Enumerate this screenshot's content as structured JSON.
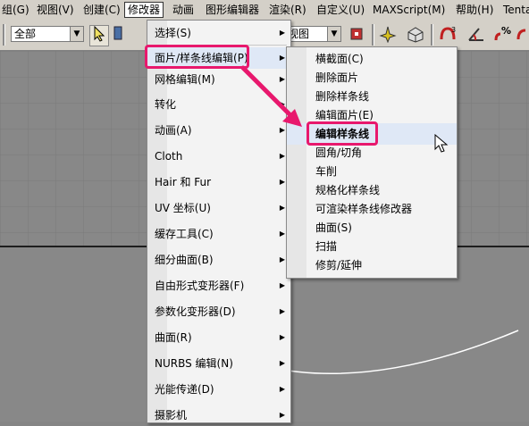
{
  "menubar": {
    "items": [
      "组(G)",
      "视图(V)",
      "创建(C)",
      "修改器",
      "动画",
      "图形编辑器",
      "渲染(R)",
      "自定义(U)",
      "MAXScript(M)",
      "帮助(H)",
      "Tenta"
    ]
  },
  "toolbar": {
    "selection_filter": "全部",
    "view_combo": "视图"
  },
  "modifiers_menu": {
    "items": [
      {
        "label": "选择(S)"
      },
      {
        "label": "面片/样条线编辑(P)"
      },
      {
        "label": "网格编辑(M)"
      },
      {
        "label": "转化"
      },
      {
        "label": "动画(A)"
      },
      {
        "label": "Cloth"
      },
      {
        "label": "Hair 和 Fur"
      },
      {
        "label": "UV 坐标(U)"
      },
      {
        "label": "缓存工具(C)"
      },
      {
        "label": "细分曲面(B)"
      },
      {
        "label": "自由形式变形器(F)"
      },
      {
        "label": "参数化变形器(D)"
      },
      {
        "label": "曲面(R)"
      },
      {
        "label": "NURBS 编辑(N)"
      },
      {
        "label": "光能传递(D)"
      },
      {
        "label": "摄影机"
      }
    ]
  },
  "patch_spline_submenu": {
    "items": [
      {
        "label": "横截面(C)"
      },
      {
        "label": "删除面片"
      },
      {
        "label": "删除样条线"
      },
      {
        "label": "编辑面片(E)"
      },
      {
        "label": "编辑样条线"
      },
      {
        "label": "圆角/切角"
      },
      {
        "label": "车削"
      },
      {
        "label": "规格化样条线"
      },
      {
        "label": "可渲染样条线修改器"
      },
      {
        "label": "曲面(S)"
      },
      {
        "label": "扫描"
      },
      {
        "label": "修剪/延伸"
      }
    ]
  },
  "colors": {
    "highlight": "#e8186d",
    "menu_bg": "#f3f3f3",
    "hover_bg": "#dfe8f6"
  }
}
